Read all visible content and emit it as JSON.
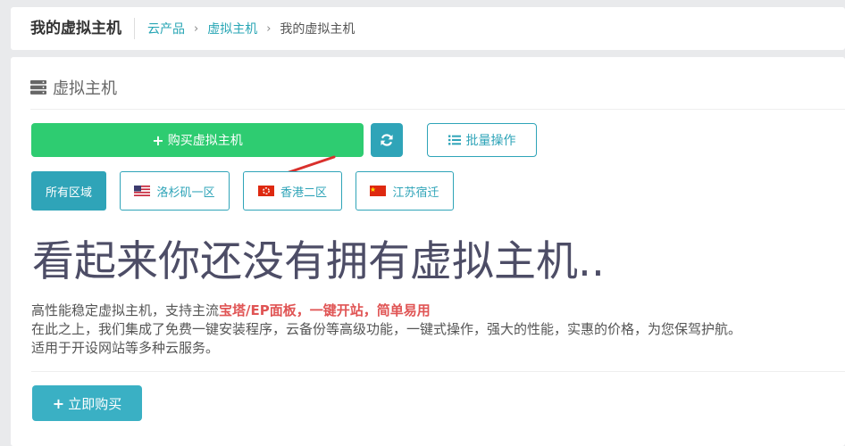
{
  "header": {
    "title": "我的虚拟主机",
    "breadcrumb": [
      {
        "label": "云产品",
        "link": true
      },
      {
        "label": "虚拟主机",
        "link": true
      },
      {
        "label": "我的虚拟主机",
        "link": false
      }
    ],
    "separator": "›"
  },
  "panel": {
    "title": "虚拟主机",
    "title_icon": "server-icon"
  },
  "toolbar": {
    "buy_label": "购买虚拟主机",
    "buy_icon": "plus-icon",
    "refresh_icon": "refresh-icon",
    "batch_label": "批量操作",
    "batch_icon": "list-icon"
  },
  "regions": [
    {
      "label": "所有区域",
      "active": true
    },
    {
      "label": "洛杉矶一区",
      "flag": "us-flag-icon"
    },
    {
      "label": "香港二区",
      "flag": "hk-flag-icon"
    },
    {
      "label": "江苏宿迁",
      "flag": "cn-flag-icon"
    }
  ],
  "empty": {
    "heading": "看起来你还没有拥有虚拟主机..",
    "line1_prefix": "高性能稳定虚拟主机，支持主流",
    "line1_highlight": "宝塔/EP面板，一键开站，简单易用",
    "line2": "在此之上，我们集成了免费一键安装程序，云备份等高级功能，一键式操作，强大的性能，实惠的价格，为您保驾护航。",
    "line3": "适用于开设网站等多种云服务。",
    "cta_label": "立即购买"
  },
  "colors": {
    "primary": "#2ecc71",
    "accent": "#2fa4b8",
    "highlight": "#e05555",
    "annotation_arrow": "#d9302c"
  }
}
